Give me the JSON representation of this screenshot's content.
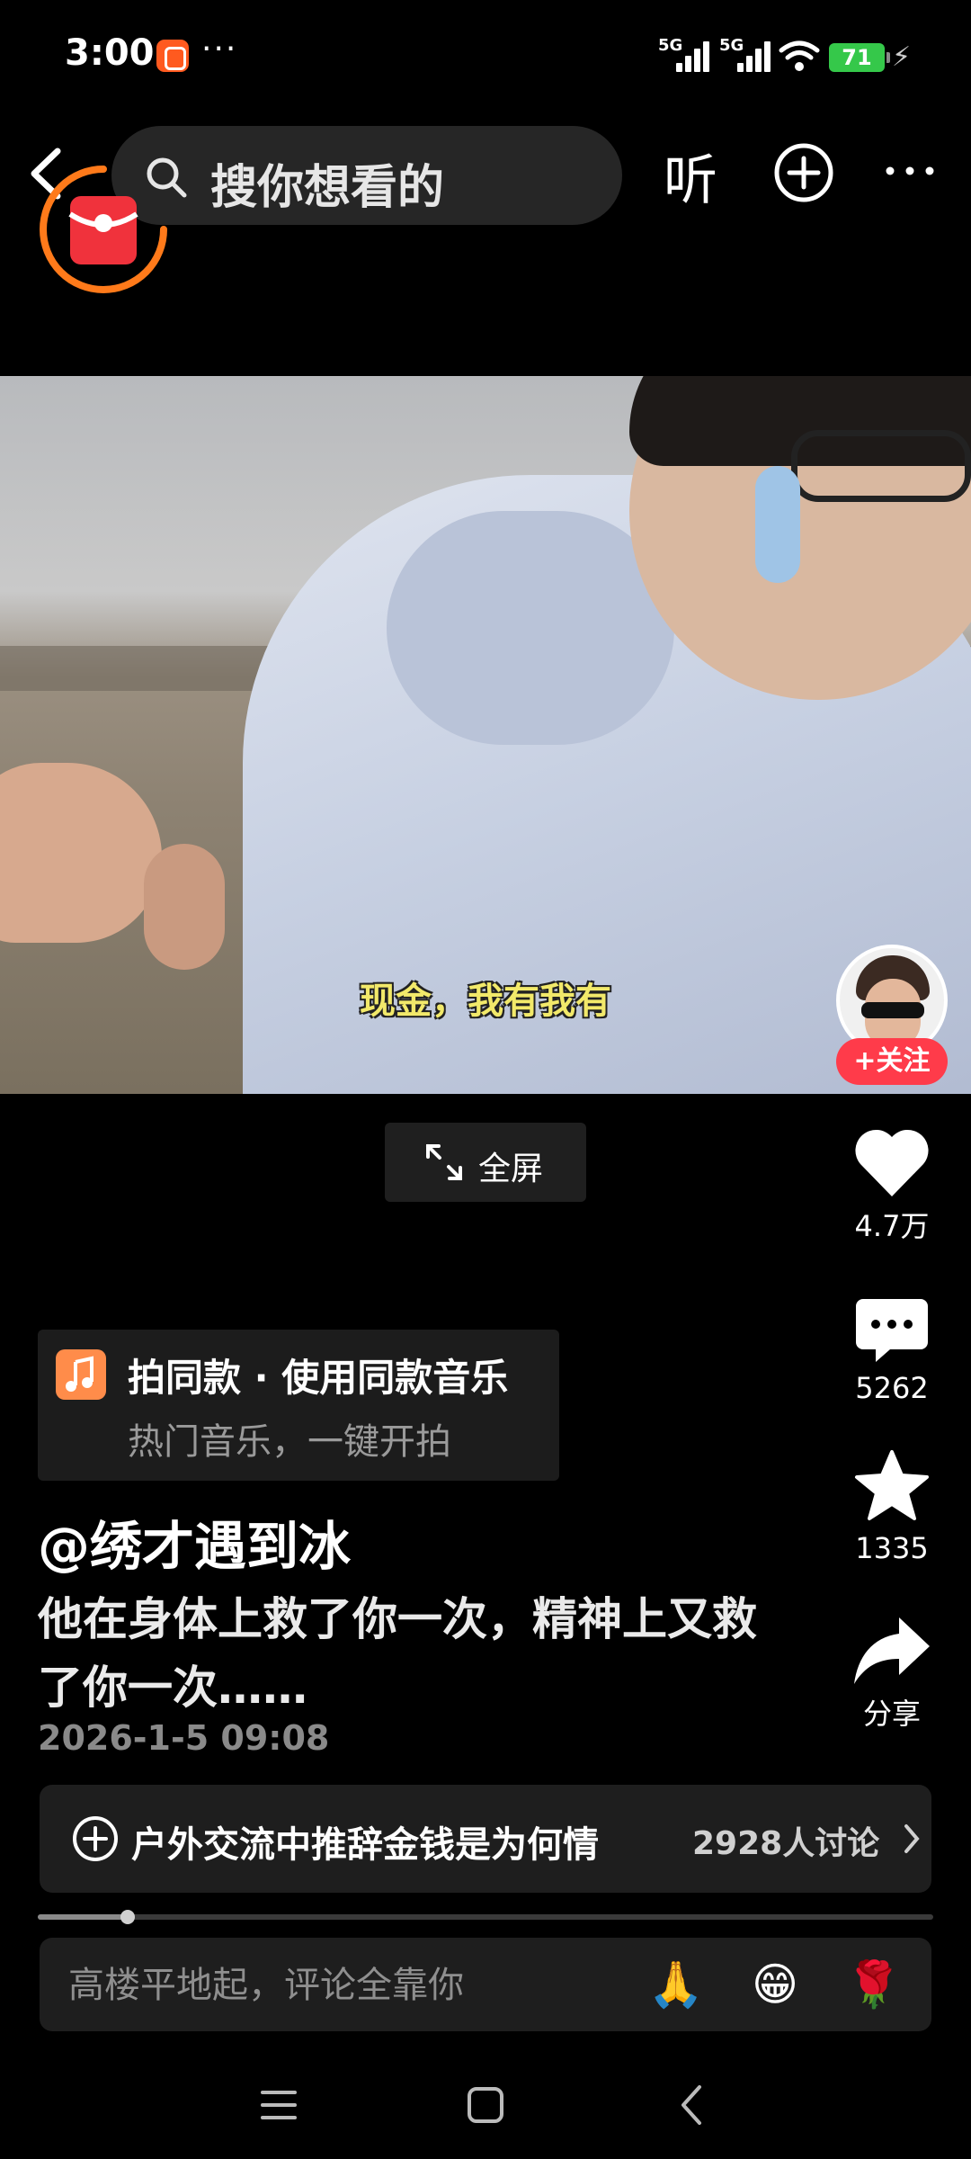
{
  "status_bar": {
    "time": "3:00",
    "dots": "···",
    "network_1": "5G",
    "network_2": "5G",
    "battery": "71",
    "battery_color": "#35c84a"
  },
  "top_nav": {
    "search_placeholder": "搜你想看的",
    "listen_label": "听",
    "icons": [
      "back-icon",
      "search-icon",
      "add-icon",
      "more-icon",
      "red-packet-icon"
    ]
  },
  "video": {
    "subtitle": "现金，我有我有"
  },
  "creator": {
    "follow_label": "+关注"
  },
  "fullscreen": {
    "label": "全屏"
  },
  "actions": {
    "like_count": "4.7万",
    "comment_count": "5262",
    "favorite_count": "1335",
    "share_label": "分享"
  },
  "music": {
    "title": "拍同款 · 使用同款音乐",
    "subtitle": "热门音乐，一键开拍"
  },
  "post": {
    "author": "@绣才遇到冰",
    "description": "他在身体上救了你一次，精神上又救了你一次……",
    "date": "2026-1-5 09:08"
  },
  "topic": {
    "text": "户外交流中推辞金钱是为何情",
    "count": "2928人讨论"
  },
  "progress": {
    "fraction": 0.1
  },
  "comment": {
    "placeholder": "高楼平地起，评论全靠你",
    "emojis": [
      "🙏",
      "😁",
      "🌹"
    ]
  },
  "colors": {
    "accent_red": "#ff3b4a",
    "music_orange": "#ff8c4a"
  }
}
